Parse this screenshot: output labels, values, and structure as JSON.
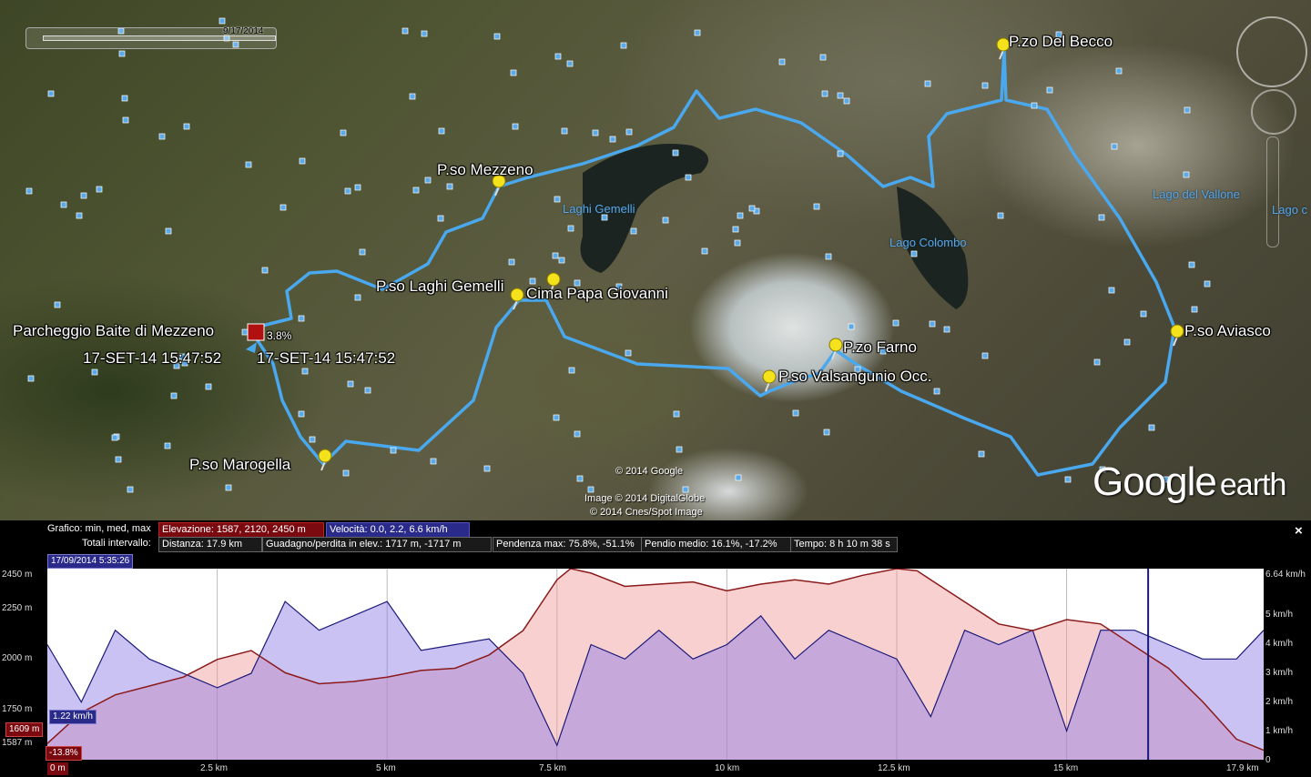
{
  "map": {
    "time_slider_date": "9/17/2014",
    "placemarks": [
      {
        "label": "P.zo Del Becco"
      },
      {
        "label": "P.so Mezzeno"
      },
      {
        "label": "P.so Laghi Gemelli"
      },
      {
        "label": "Cima Papa Giovanni"
      },
      {
        "label": "Parcheggio Baite di Mezzeno"
      },
      {
        "label": "P.zo Farno"
      },
      {
        "label": "P.so Valsangunio Occ."
      },
      {
        "label": "P.so Aviasco"
      },
      {
        "label": "P.so Marogella"
      }
    ],
    "lakes": [
      "Laghi Gemelli",
      "Lago Colombo",
      "Lago del Vallone",
      "Lago c"
    ],
    "cursor_grade": "3.8%",
    "cursor_time_1": "17-SET-14 15:47:52",
    "cursor_time_2": "17-SET-14 15:47:52",
    "copyright_1": "© 2014 Google",
    "copyright_2": "Image © 2014 DigitalGlobe",
    "copyright_3": "© 2014 Cnes/Spot Image",
    "logo_google": "Google",
    "logo_earth": "earth",
    "track_color": "#4aa8ee",
    "pin_color": "#f3e21c"
  },
  "profile": {
    "close_label": "×",
    "row1_label": "Grafico: min, med, max",
    "elevation": "Elevazione: 1587, 2120, 2450 m",
    "speed": "Velocità: 0.0, 2.2, 6.6 km/h",
    "row2_label": "Totali intervallo:",
    "distance": "Distanza: 17.9 km",
    "gain_loss": "Guadagno/perdita in elev.: 1717 m, -1717 m",
    "max_grade": "Pendenza max: 75.8%, -51.1%",
    "avg_grade": "Pendio medio: 16.1%, -17.2%",
    "time": "Tempo: 8 h 10 m 38 s",
    "cursor_date": "17/09/2014 5:35:26",
    "cursor_speed": "1.22 km/h",
    "cursor_elev": "1609 m",
    "cursor_grade": "-13.8%",
    "elev_color": "#8b1a1a",
    "speed_color": "#1a1a7a",
    "y_left_ticks": [
      "2450 m",
      "2250 m",
      "2000 m",
      "1750 m",
      "1587 m"
    ],
    "y_right_ticks": [
      "6.64 km/h",
      "5 km/h",
      "4 km/h",
      "3 km/h",
      "2 km/h",
      "1 km/h",
      "0"
    ],
    "x_ticks": [
      "0 m",
      "2.5 km",
      "5 km",
      "7.5 km",
      "10 km",
      "12.5 km",
      "15 km",
      "17.9 km"
    ]
  },
  "chart_data": {
    "type": "area",
    "xlabel": "",
    "ylabel": "",
    "xlim": [
      0,
      17.9
    ],
    "ylim": [
      1587,
      2450
    ],
    "y2lim": [
      0,
      6.64
    ],
    "series": [
      {
        "name": "Elevazione",
        "x": [
          0,
          0.5,
          1.0,
          1.5,
          2.0,
          2.5,
          3.0,
          3.5,
          4.0,
          4.5,
          5.0,
          5.5,
          6.0,
          6.5,
          7.0,
          7.5,
          7.7,
          8.0,
          8.5,
          9.0,
          9.5,
          10.0,
          10.5,
          11.0,
          11.5,
          12.0,
          12.5,
          12.8,
          13.0,
          13.5,
          14.0,
          14.5,
          15.0,
          15.5,
          16.0,
          16.5,
          17.0,
          17.5,
          17.9
        ],
        "values": [
          1660,
          1800,
          1880,
          1920,
          1960,
          2040,
          2080,
          1980,
          1930,
          1940,
          1960,
          1990,
          2000,
          2060,
          2170,
          2400,
          2450,
          2430,
          2370,
          2380,
          2390,
          2350,
          2380,
          2400,
          2380,
          2420,
          2450,
          2440,
          2400,
          2300,
          2200,
          2170,
          2220,
          2200,
          2100,
          2000,
          1850,
          1680,
          1630
        ]
      },
      {
        "name": "Velocità",
        "x": [
          0,
          0.5,
          1.0,
          1.5,
          2.0,
          2.5,
          3.0,
          3.5,
          4.0,
          4.5,
          5.0,
          5.5,
          6.0,
          6.5,
          7.0,
          7.5,
          8.0,
          8.5,
          9.0,
          9.5,
          10.0,
          10.5,
          11.0,
          11.5,
          12.0,
          12.5,
          13.0,
          13.5,
          14.0,
          14.5,
          15.0,
          15.5,
          16.0,
          16.5,
          17.0,
          17.5,
          17.9
        ],
        "values": [
          4.0,
          2.0,
          4.5,
          3.5,
          3.0,
          2.5,
          3.0,
          5.5,
          4.5,
          5.0,
          5.5,
          3.8,
          4.0,
          4.2,
          3.0,
          0.5,
          4.0,
          3.5,
          4.5,
          3.5,
          4.0,
          5.0,
          3.5,
          4.5,
          4.0,
          3.5,
          1.5,
          4.5,
          4.0,
          4.5,
          1.0,
          4.5,
          4.5,
          4.0,
          3.5,
          3.5,
          4.5
        ]
      }
    ]
  }
}
